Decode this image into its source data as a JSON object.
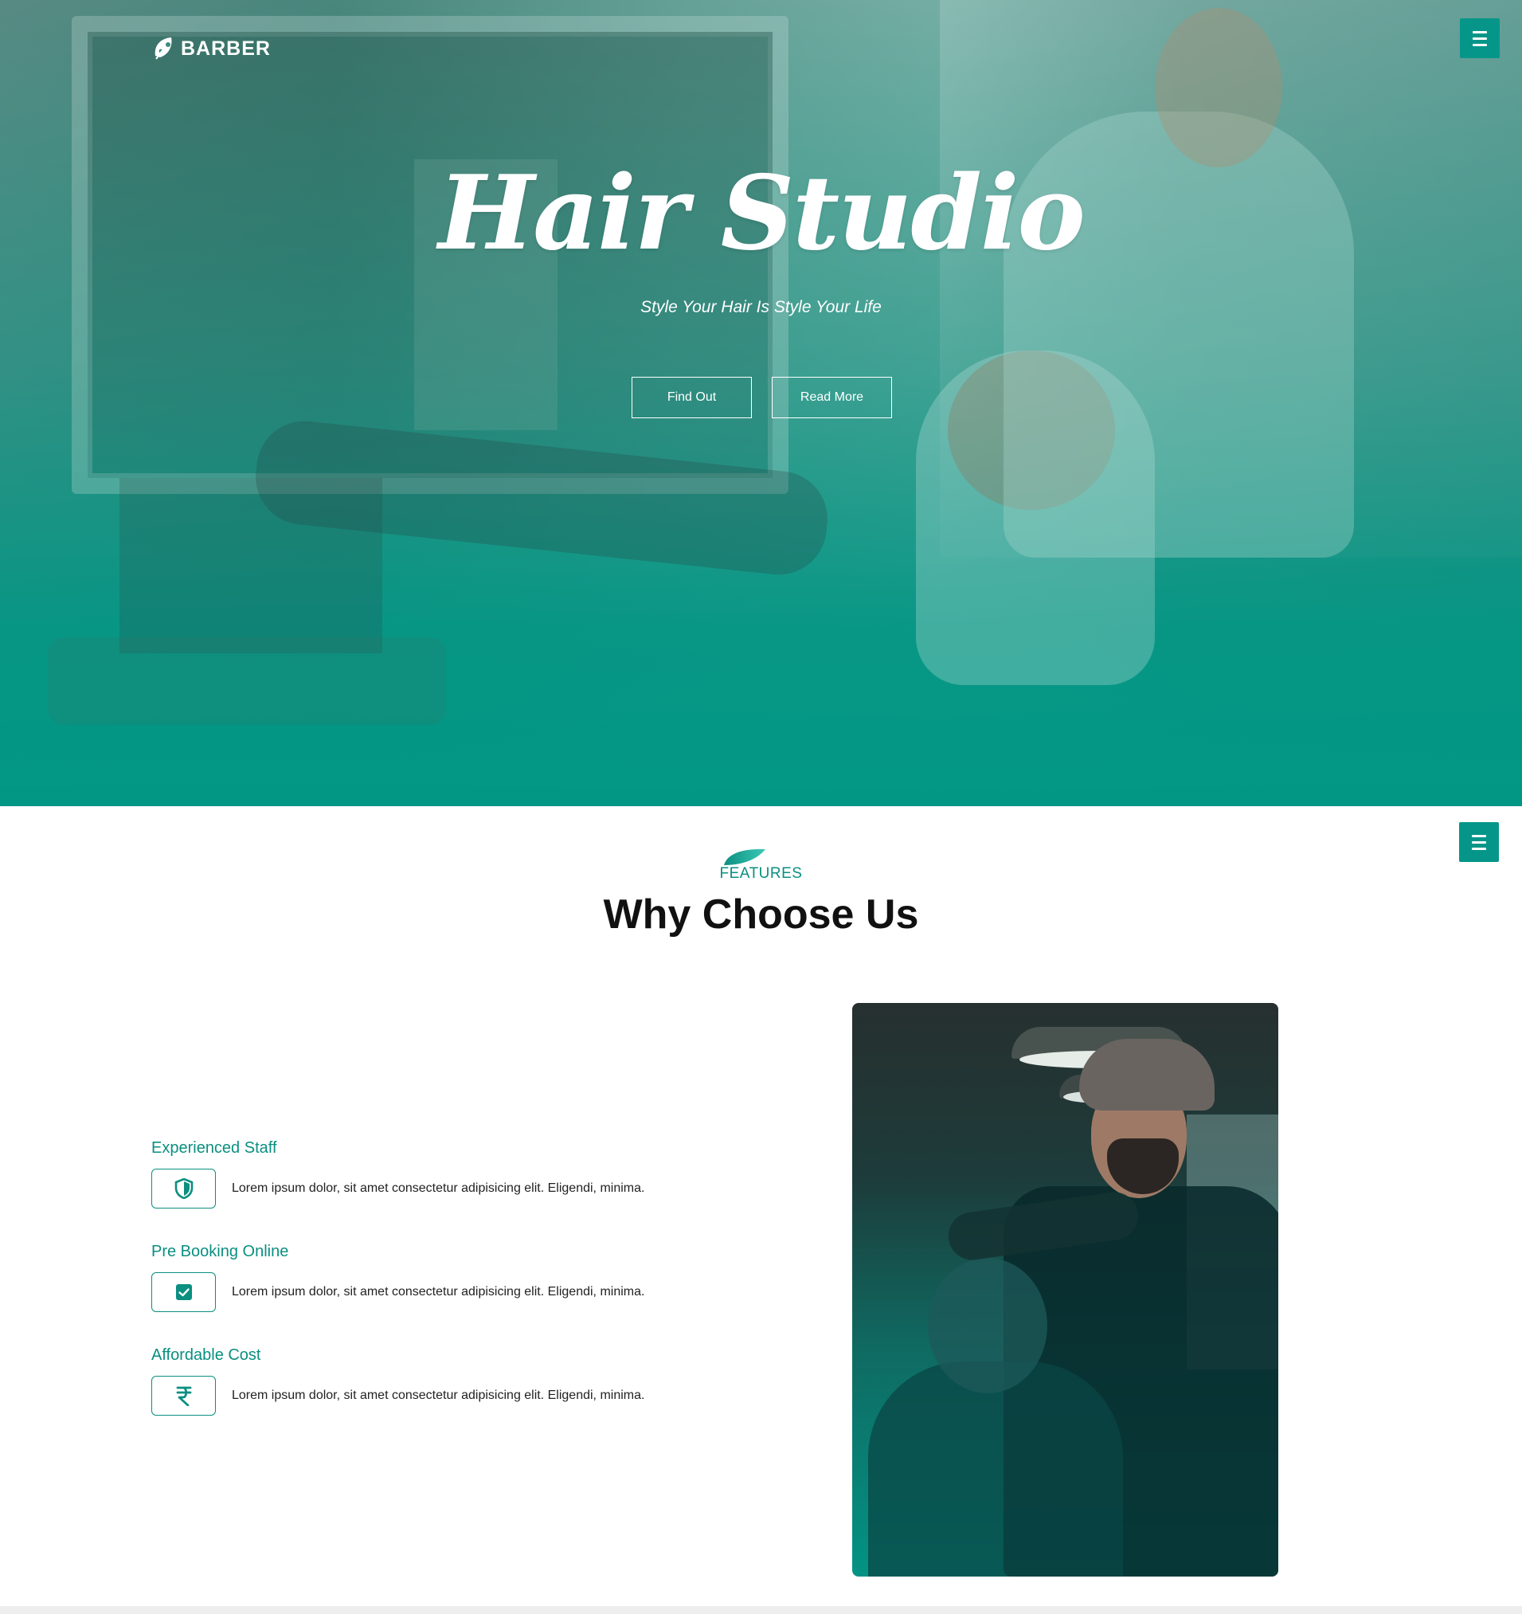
{
  "colors": {
    "accent": "#059689",
    "accent_text": "#0a8f80",
    "hero_overlay": "#029785"
  },
  "header": {
    "logo_text": "BARBER",
    "logo_icon": "leaf-logo-icon",
    "menu_icon": "hamburger-menu-icon"
  },
  "hero": {
    "title": "Hair Studio",
    "subtitle": "Style Your Hair Is Style Your Life",
    "buttons": [
      {
        "label": "Find Out"
      },
      {
        "label": "Read More"
      }
    ]
  },
  "features": {
    "label": "FEATURES",
    "title": "Why Choose Us",
    "items": [
      {
        "title": "Experienced Staff",
        "icon": "shield-icon",
        "text": "Lorem ipsum dolor, sit amet consectetur adipisicing elit. Eligendi, minima."
      },
      {
        "title": "Pre Booking Online",
        "icon": "check-square-icon",
        "text": "Lorem ipsum dolor, sit amet consectetur adipisicing elit. Eligendi, minima."
      },
      {
        "title": "Affordable Cost",
        "icon": "rupee-icon",
        "text": "Lorem ipsum dolor, sit amet consectetur adipisicing elit. Eligendi, minima."
      }
    ]
  }
}
